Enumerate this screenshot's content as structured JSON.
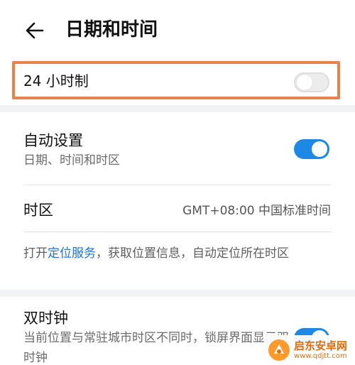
{
  "header": {
    "title": "日期和时间",
    "back_icon": "arrow-left-icon"
  },
  "hour24": {
    "label": "24 小时制",
    "enabled": false
  },
  "auto_setting": {
    "title": "自动设置",
    "subtitle": "日期、时间和时区",
    "enabled": true
  },
  "timezone": {
    "label": "时区",
    "value": "GMT+08:00 中国标准时间"
  },
  "location_hint": {
    "prefix": "打开",
    "link": "定位服务",
    "suffix": "，获取位置信息，自动定位所在时区"
  },
  "dual_clock": {
    "title": "双时钟",
    "subtitle": "当前位置与常驻城市时区不同时，锁屏界面显示双时钟",
    "enabled": true
  },
  "watermark": {
    "name": "启东安卓网",
    "url": "www.qdjtt.com"
  },
  "colors": {
    "accent": "#1e88e5",
    "highlight": "#e8814a",
    "link": "#1a73d9"
  }
}
